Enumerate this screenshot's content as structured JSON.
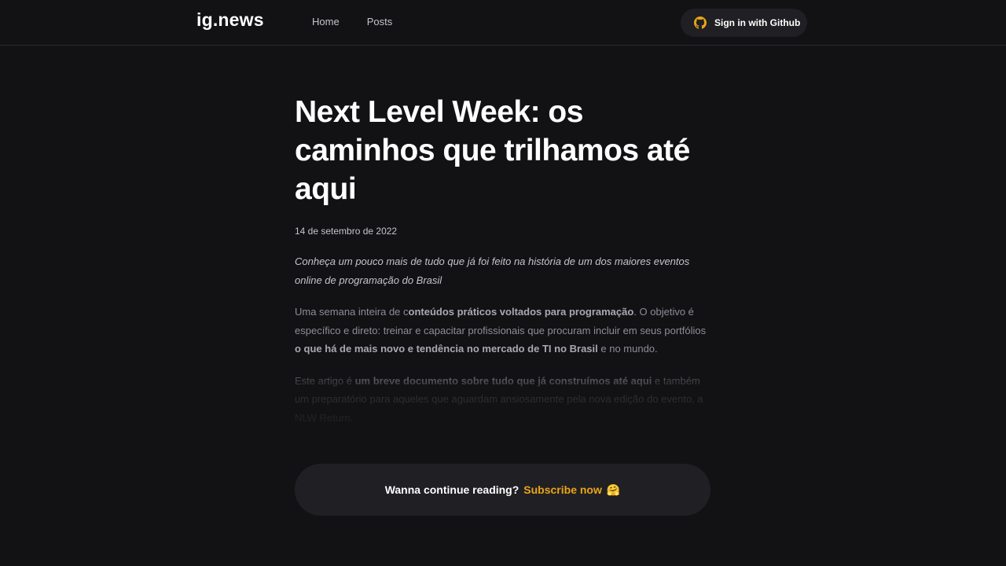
{
  "header": {
    "logo": "ig.news",
    "nav": [
      {
        "label": "Home"
      },
      {
        "label": "Posts"
      }
    ],
    "signin": {
      "label": "Sign in with Github",
      "icon": "github-icon",
      "icon_color": "#eba417"
    }
  },
  "post": {
    "title": "Next Level Week: os caminhos que trilhamos até aqui",
    "date": "14 de setembro de 2022",
    "intro": "Conheça um pouco mais de tudo que já foi feito na história de um dos maiores eventos online de programação do Brasil",
    "p1": {
      "t1": "Uma semana inteira de c",
      "b1": "onteúdos práticos voltados para programação",
      "t2": ". O objetivo é específico e direto: treinar e capacitar profissionais que procuram incluir em seus portfólios ",
      "b2": "o que há de mais novo e tendência no mercado de TI no Brasil",
      "t3": " e no mundo."
    },
    "p2": {
      "t1": "Este artigo é ",
      "b1": "um breve documento sobre tudo que já construímos até aqui",
      "t2": " e também um preparatório para aqueles que aguardam ansiosamente pela nova edição do evento, a NLW Return."
    }
  },
  "subscribe": {
    "text": "Wanna continue reading?",
    "link": "Subscribe now",
    "emoji": "🤗",
    "accent": "#eba417"
  }
}
